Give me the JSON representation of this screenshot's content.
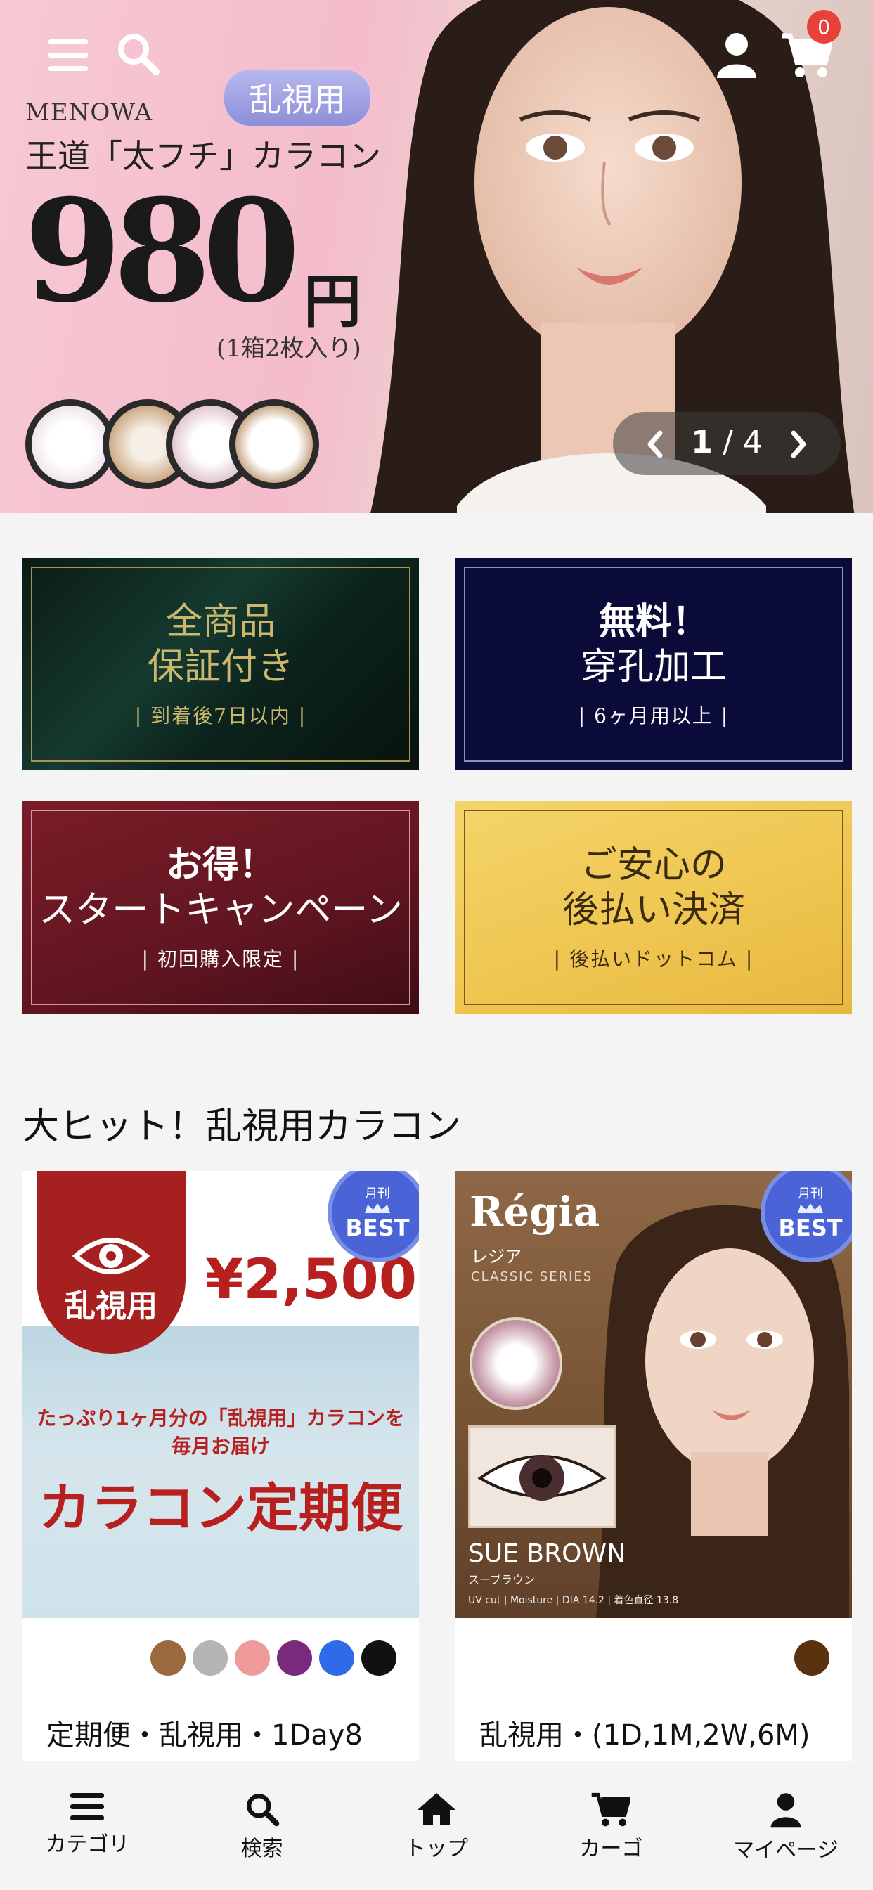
{
  "hero": {
    "cart_count": "0",
    "tag": "乱視用",
    "brand": "MENOWA",
    "title": "王道「太フチ」カラコン",
    "price": "980",
    "price_unit": "円",
    "note": "(1箱2枚入り)",
    "slider": {
      "current": "1",
      "separator": " / ",
      "total": "4"
    },
    "icons": [
      "menu-icon",
      "search-icon",
      "user-icon",
      "cart-icon",
      "chevron-left-icon",
      "chevron-right-icon"
    ]
  },
  "features": [
    {
      "line1": "全商品",
      "line2": "保証付き",
      "sub": "| 到着後7日以内 |"
    },
    {
      "line1": "無料！",
      "line2": "穿孔加工",
      "sub": "| 6ヶ月用以上 |"
    },
    {
      "line1": "お得！",
      "line2": "スタートキャンペーン",
      "sub": "| 初回購入限定 |"
    },
    {
      "line1": "ご安心の",
      "line2": "後払い決済",
      "sub": "| 後払いドットコム |"
    }
  ],
  "section": {
    "title": "大ヒット！乱視用カラコン"
  },
  "products": [
    {
      "badge_month": "月刊",
      "badge_label": "BEST",
      "art": {
        "tag": "乱視用",
        "price": "¥2,500",
        "line1": "たっぷり1ヶ月分の「乱視用」カラコンを",
        "line2": "毎月お届け",
        "headline": "カラコン定期便"
      },
      "swatches": [
        "#9a6a3e",
        "#b5b5b5",
        "#ee9a9a",
        "#7a2a7a",
        "#2f6ae8",
        "#111111"
      ],
      "title": "定期便・乱視用・1Day8"
    },
    {
      "badge_month": "月刊",
      "badge_label": "BEST",
      "art": {
        "brand": "Régia",
        "kana": "レジア",
        "series": "CLASSIC SERIES",
        "name": "SUE BROWN",
        "sub": "スーブラウン",
        "specs": "UV cut | Moisture | DIA 14.2 | 着色直径 13.8"
      },
      "swatches": [
        "#5b3210"
      ],
      "title": "乱視用・(1D,1M,2W,6M)"
    }
  ],
  "nav": [
    {
      "label": "カテゴリ",
      "icon": "menu-icon"
    },
    {
      "label": "検索",
      "icon": "search-icon"
    },
    {
      "label": "トップ",
      "icon": "home-icon"
    },
    {
      "label": "カーゴ",
      "icon": "cart-icon"
    },
    {
      "label": "マイページ",
      "icon": "user-icon"
    }
  ]
}
